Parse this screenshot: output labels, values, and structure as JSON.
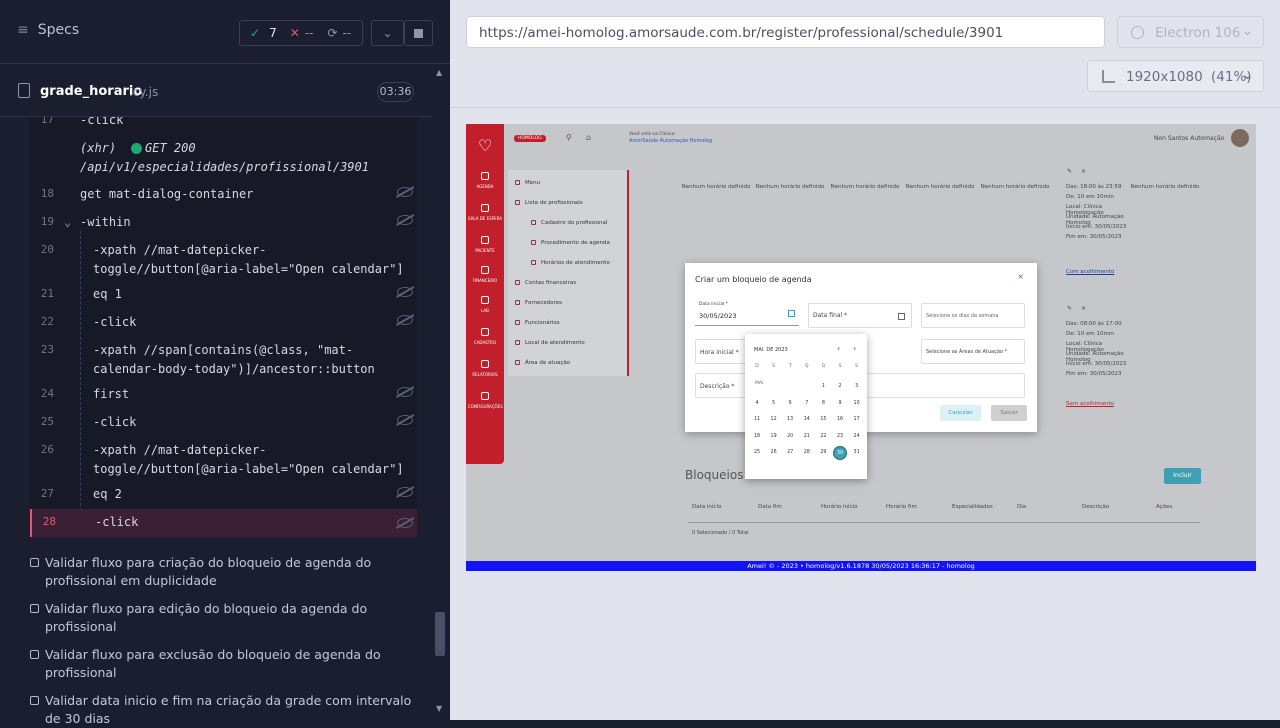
{
  "runner": {
    "specs_label": "Specs",
    "passed": "7",
    "failed": "--",
    "pending": "--",
    "spec_file": "grade_horario",
    "spec_ext": ".cy.js",
    "duration": "03:36"
  },
  "commands": [
    {
      "n": "17",
      "text": "-click"
    },
    {
      "n": "",
      "text": "(xhr)"
    },
    {
      "n": "",
      "text": "GET 200"
    },
    {
      "n": "",
      "text": "/api/v1/especialidades/profissional/3901"
    },
    {
      "n": "18",
      "text": "get  mat-dialog-container"
    },
    {
      "n": "19",
      "text": "-within"
    },
    {
      "n": "20",
      "text": "-xpath  //mat-datepicker-"
    },
    {
      "n": "",
      "text": "toggle//button[@aria-label=\"Open calendar\"]"
    },
    {
      "n": "21",
      "text": "eq  1"
    },
    {
      "n": "22",
      "text": "-click"
    },
    {
      "n": "23",
      "text": "-xpath  //span[contains(@class, \"mat-"
    },
    {
      "n": "",
      "text": "calendar-body-today\")]/ancestor::button"
    },
    {
      "n": "24",
      "text": "first"
    },
    {
      "n": "25",
      "text": "-click"
    },
    {
      "n": "26",
      "text": "-xpath  //mat-datepicker-"
    },
    {
      "n": "",
      "text": "toggle//button[@aria-label=\"Open calendar\"]"
    },
    {
      "n": "27",
      "text": "eq  2"
    },
    {
      "n": "28",
      "text": "-click"
    }
  ],
  "tests": [
    "Validar fluxo para criação do bloqueio de agenda do profissional em duplicidade",
    "Validar fluxo para edição do bloqueio da agenda do profissional",
    "Validar fluxo para exclusão do bloqueio de agenda do profissional",
    "Validar data inicio e fim na criação da grade com intervalo de 30 dias"
  ],
  "browser": {
    "url": "https://amei-homolog.amorsaude.com.br/register/professional/schedule/3901",
    "name": "Electron 106",
    "resolution": "1920x1080",
    "scale": "(41%)"
  },
  "app": {
    "env_badge": "HOMOLOG",
    "clinic_label": "Você está na Clínica:",
    "clinic_name": "AmorSaúde Automação Homolog",
    "user": "Non Santos Automação",
    "side": [
      "AGENDA",
      "SALA DE ESPERA",
      "PACIENTE",
      "FINANCEIRO",
      "LAB",
      "CADASTRO",
      "RELATÓRIOS",
      "CONFIGURAÇÕES"
    ],
    "menu": [
      "Menu",
      "Lista de profissionais",
      "Cadastro do profissional",
      "Procedimento de agenda",
      "Horários de atendimento",
      "Contas financeiras",
      "Fornecedores",
      "Funcionários",
      "Local de atendimento",
      "Área de atuação"
    ],
    "no_time": "Nenhum horário definido",
    "card1": [
      "Das: 18:00 às 23:59",
      "De: 10 em 10min",
      "Local: Clínica Homologação",
      "Unidade: Automação Homolog",
      "Início em: 30/05/2023",
      "Fim em: 30/05/2023"
    ],
    "card1_link": "Com acolhimento",
    "card2": [
      "Das: 08:00 às 17:00",
      "De: 10 em 10min",
      "Local: Clínica Homologação",
      "Unidade: Automação Homolog",
      "Início em: 30/05/2023",
      "Fim em: 30/05/2023"
    ],
    "card2_link": "Sem acolhimento",
    "blocks_title": "Bloqueios d",
    "add_btn": "Incluir",
    "table_cols": [
      "Data início",
      "Data fim",
      "Horário início",
      "Horário fim",
      "Especialidades",
      "Dia",
      "Descrição",
      "Ações"
    ],
    "selected_text": "0 Selecionado / 0 Total",
    "footer": "Amei! © - 2023 • homolog/v1.6.1878 30/05/2023 16:36:17 - homolog"
  },
  "dialog": {
    "title": "Criar um bloqueio de agenda",
    "date_start_label": "Data inicial *",
    "date_start": "30/05/2023",
    "date_end": "Data final *",
    "weekdays": "Selecione os dias da semana",
    "hora": "Hora inicial *",
    "areas": "Selecione as Áreas de Atuação *",
    "desc": "Descrição *",
    "cancel": "Cancelar",
    "save": "Salvar"
  },
  "calendar": {
    "month": "MAI. DE 2023",
    "dow": [
      "D",
      "S",
      "T",
      "Q",
      "Q",
      "S",
      "S"
    ],
    "month_short": "MAI.",
    "weeks": [
      [
        "",
        "",
        "1",
        "2",
        "3"
      ],
      [
        "4",
        "5",
        "6",
        "7",
        "8",
        "9",
        "10"
      ],
      [
        "11",
        "12",
        "13",
        "14",
        "15",
        "16",
        "17"
      ],
      [
        "18",
        "19",
        "20",
        "21",
        "22",
        "23",
        "24"
      ],
      [
        "25",
        "26",
        "27",
        "28",
        "29",
        "30",
        "31"
      ]
    ],
    "today": "30"
  }
}
